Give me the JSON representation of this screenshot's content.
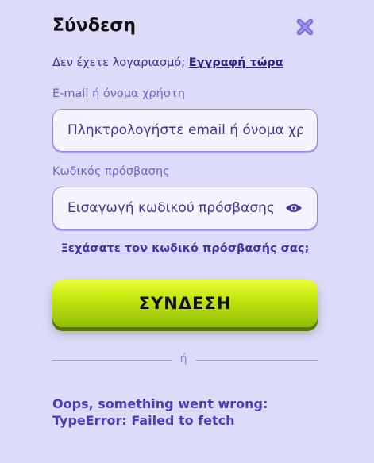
{
  "dialog": {
    "title": "Σύνδεση",
    "close_icon": "close-x-icon"
  },
  "signup": {
    "prompt": "Δεν έχετε λογαριασμό; ",
    "link": "Εγγραφή τώρα"
  },
  "email_field": {
    "label": "E-mail ή όνομα χρήστη",
    "placeholder": "Πληκτρολογήστε email ή όνομα χρήστη",
    "value": ""
  },
  "password_field": {
    "label": "Κωδικός πρόσβασης",
    "placeholder": "Εισαγωγή κωδικού πρόσβασης",
    "value": "",
    "toggle_icon": "eye-icon"
  },
  "forgot_password": "Ξεχάσατε τον κωδικό πρόσβασής σας;",
  "login_button": "ΣΥΝΔΕΣΗ",
  "divider_text": "ή",
  "error": {
    "line1": "Oops, something went wrong:",
    "line2": "TypeError: Failed to fetch"
  },
  "colors": {
    "background": "#dcdcfa",
    "accent": "#b7de10",
    "link": "#2a2483",
    "error": "#4a3cb8"
  }
}
